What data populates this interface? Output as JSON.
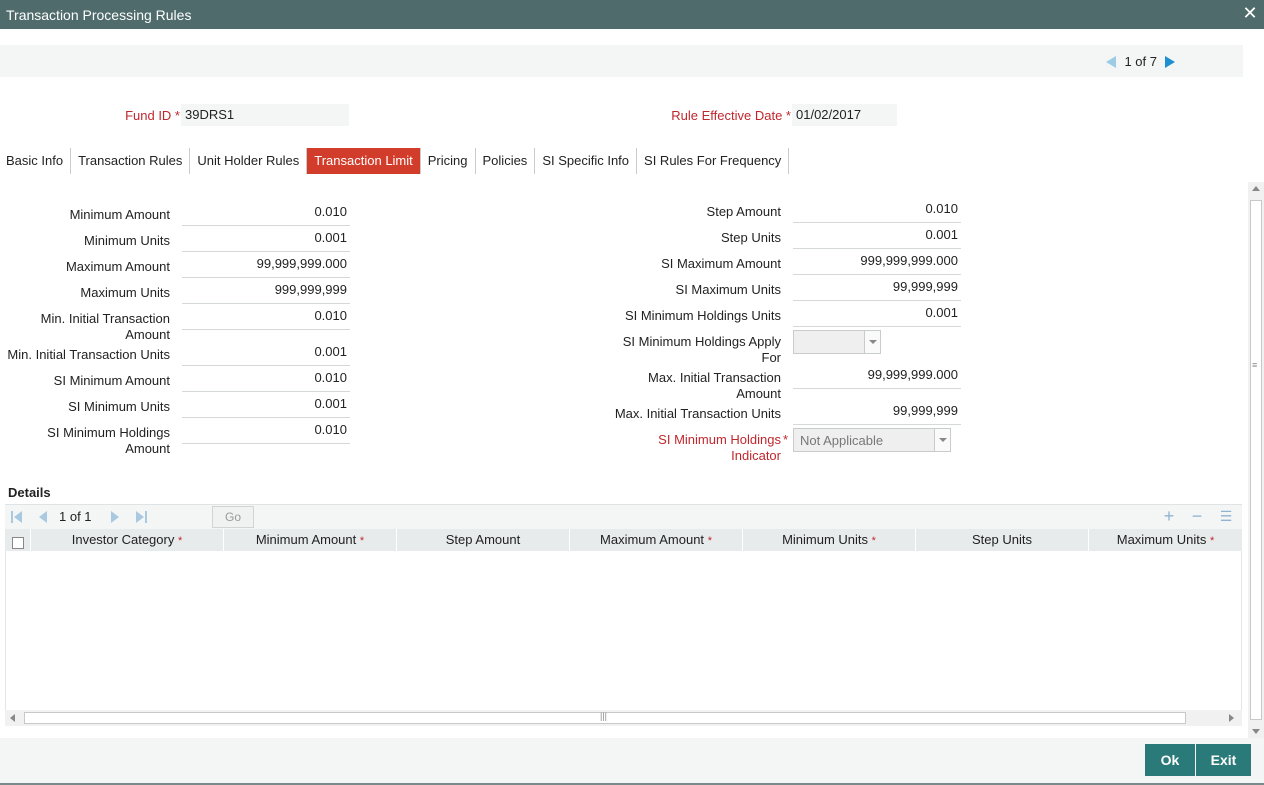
{
  "window": {
    "title": "Transaction Processing Rules"
  },
  "pager": {
    "text": "1 of 7"
  },
  "header": {
    "fund_id_label": "Fund ID *",
    "fund_id_value": "39DRS1",
    "effective_date_label": "Rule Effective Date *",
    "effective_date_value": "01/02/2017"
  },
  "tabs": [
    {
      "label": "Basic Info"
    },
    {
      "label": "Transaction Rules"
    },
    {
      "label": "Unit Holder Rules"
    },
    {
      "label": "Transaction Limit",
      "active": true
    },
    {
      "label": "Pricing"
    },
    {
      "label": "Policies"
    },
    {
      "label": "SI Specific Info"
    },
    {
      "label": "SI Rules For Frequency"
    }
  ],
  "left_fields": [
    {
      "label": "Minimum Amount",
      "value": "0.010"
    },
    {
      "label": "Minimum Units",
      "value": "0.001"
    },
    {
      "label": "Maximum Amount",
      "value": "99,999,999.000"
    },
    {
      "label": "Maximum Units",
      "value": "999,999,999"
    },
    {
      "label": "Min. Initial Transaction Amount",
      "value": "0.010"
    },
    {
      "label": "Min. Initial Transaction Units",
      "value": "0.001"
    },
    {
      "label": "SI Minimum Amount",
      "value": "0.010"
    },
    {
      "label": "SI Minimum Units",
      "value": "0.001"
    },
    {
      "label": "SI Minimum Holdings Amount",
      "value": "0.010"
    }
  ],
  "right_fields": [
    {
      "label": "Step Amount",
      "value": "0.010"
    },
    {
      "label": "Step Units",
      "value": "0.001"
    },
    {
      "label": "SI Maximum Amount",
      "value": "999,999,999.000"
    },
    {
      "label": "SI Maximum Units",
      "value": "99,999,999"
    },
    {
      "label": "SI Minimum Holdings Units",
      "value": "0.001"
    },
    {
      "label": "SI Minimum Holdings Apply For",
      "value": ""
    },
    {
      "label": "Max. Initial Transaction Amount",
      "value": "99,999,999.000"
    },
    {
      "label": "Max. Initial Transaction Units",
      "value": "99,999,999"
    },
    {
      "label": "SI Minimum Holdings Indicator",
      "value": "Not Applicable",
      "required": true
    }
  ],
  "details": {
    "title": "Details",
    "page_text": "1 of 1",
    "go_label": "Go",
    "columns": [
      {
        "label": "Investor Category",
        "required": true
      },
      {
        "label": "Minimum Amount",
        "required": true
      },
      {
        "label": "Step Amount",
        "required": false
      },
      {
        "label": "Maximum Amount",
        "required": true
      },
      {
        "label": "Minimum Units",
        "required": true
      },
      {
        "label": "Step Units",
        "required": false
      },
      {
        "label": "Maximum Units",
        "required": true
      }
    ]
  },
  "footer": {
    "ok_label": "Ok",
    "exit_label": "Exit"
  },
  "colors": {
    "titlebar": "#4f6b6b",
    "active_tab": "#d23c2a",
    "required": "#c0272d",
    "button": "#2b7a7a"
  }
}
